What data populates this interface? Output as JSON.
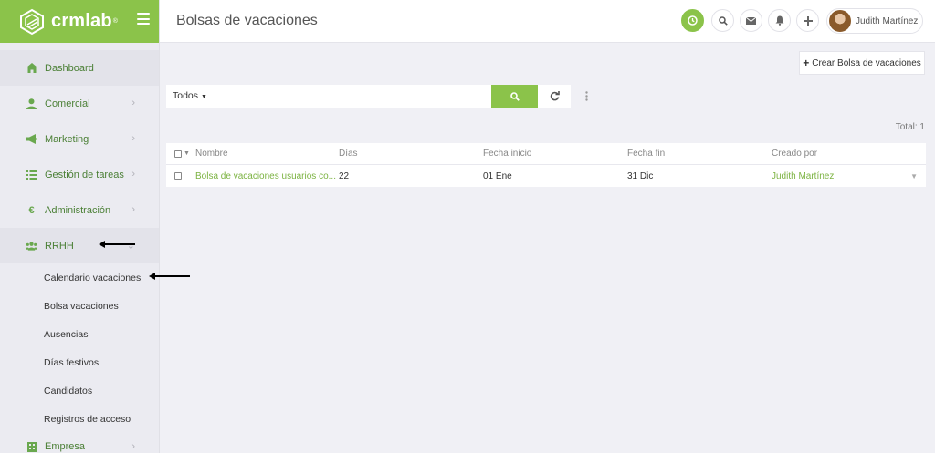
{
  "brand": {
    "name": "crmlab",
    "reg": "®"
  },
  "header": {
    "title": "Bolsas de vacaciones",
    "user_name": "Judith Martínez",
    "icons": [
      "clock-icon",
      "search-icon",
      "mail-icon",
      "bell-icon",
      "plus-icon"
    ],
    "accent_color": "#8bc34a"
  },
  "sidebar": {
    "items": [
      {
        "label": "Dashboard",
        "icon": "home-icon"
      },
      {
        "label": "Comercial",
        "icon": "user-icon"
      },
      {
        "label": "Marketing",
        "icon": "megaphone-icon"
      },
      {
        "label": "Gestión de tareas",
        "icon": "list-icon"
      },
      {
        "label": "Administración",
        "icon": "euro-icon"
      },
      {
        "label": "RRHH",
        "icon": "users-icon"
      }
    ],
    "subitems": [
      "Calendario vacaciones",
      "Bolsa vacaciones",
      "Ausencias",
      "Días festivos",
      "Candidatos",
      "Registros de acceso"
    ],
    "last_item": {
      "label": "Empresa",
      "icon": "building-icon"
    }
  },
  "toolbar": {
    "create_label": "Crear Bolsa de vacaciones",
    "filter_label": "Todos",
    "total": "Total: 1"
  },
  "table": {
    "columns": [
      "Nombre",
      "Días",
      "Fecha inicio",
      "Fecha fin",
      "Creado por"
    ],
    "rows": [
      {
        "nombre": "Bolsa de vacaciones usuarios co...",
        "dias": "22",
        "inicio": "01 Ene",
        "fin": "31 Dic",
        "creado": "Judith Martínez"
      }
    ]
  }
}
